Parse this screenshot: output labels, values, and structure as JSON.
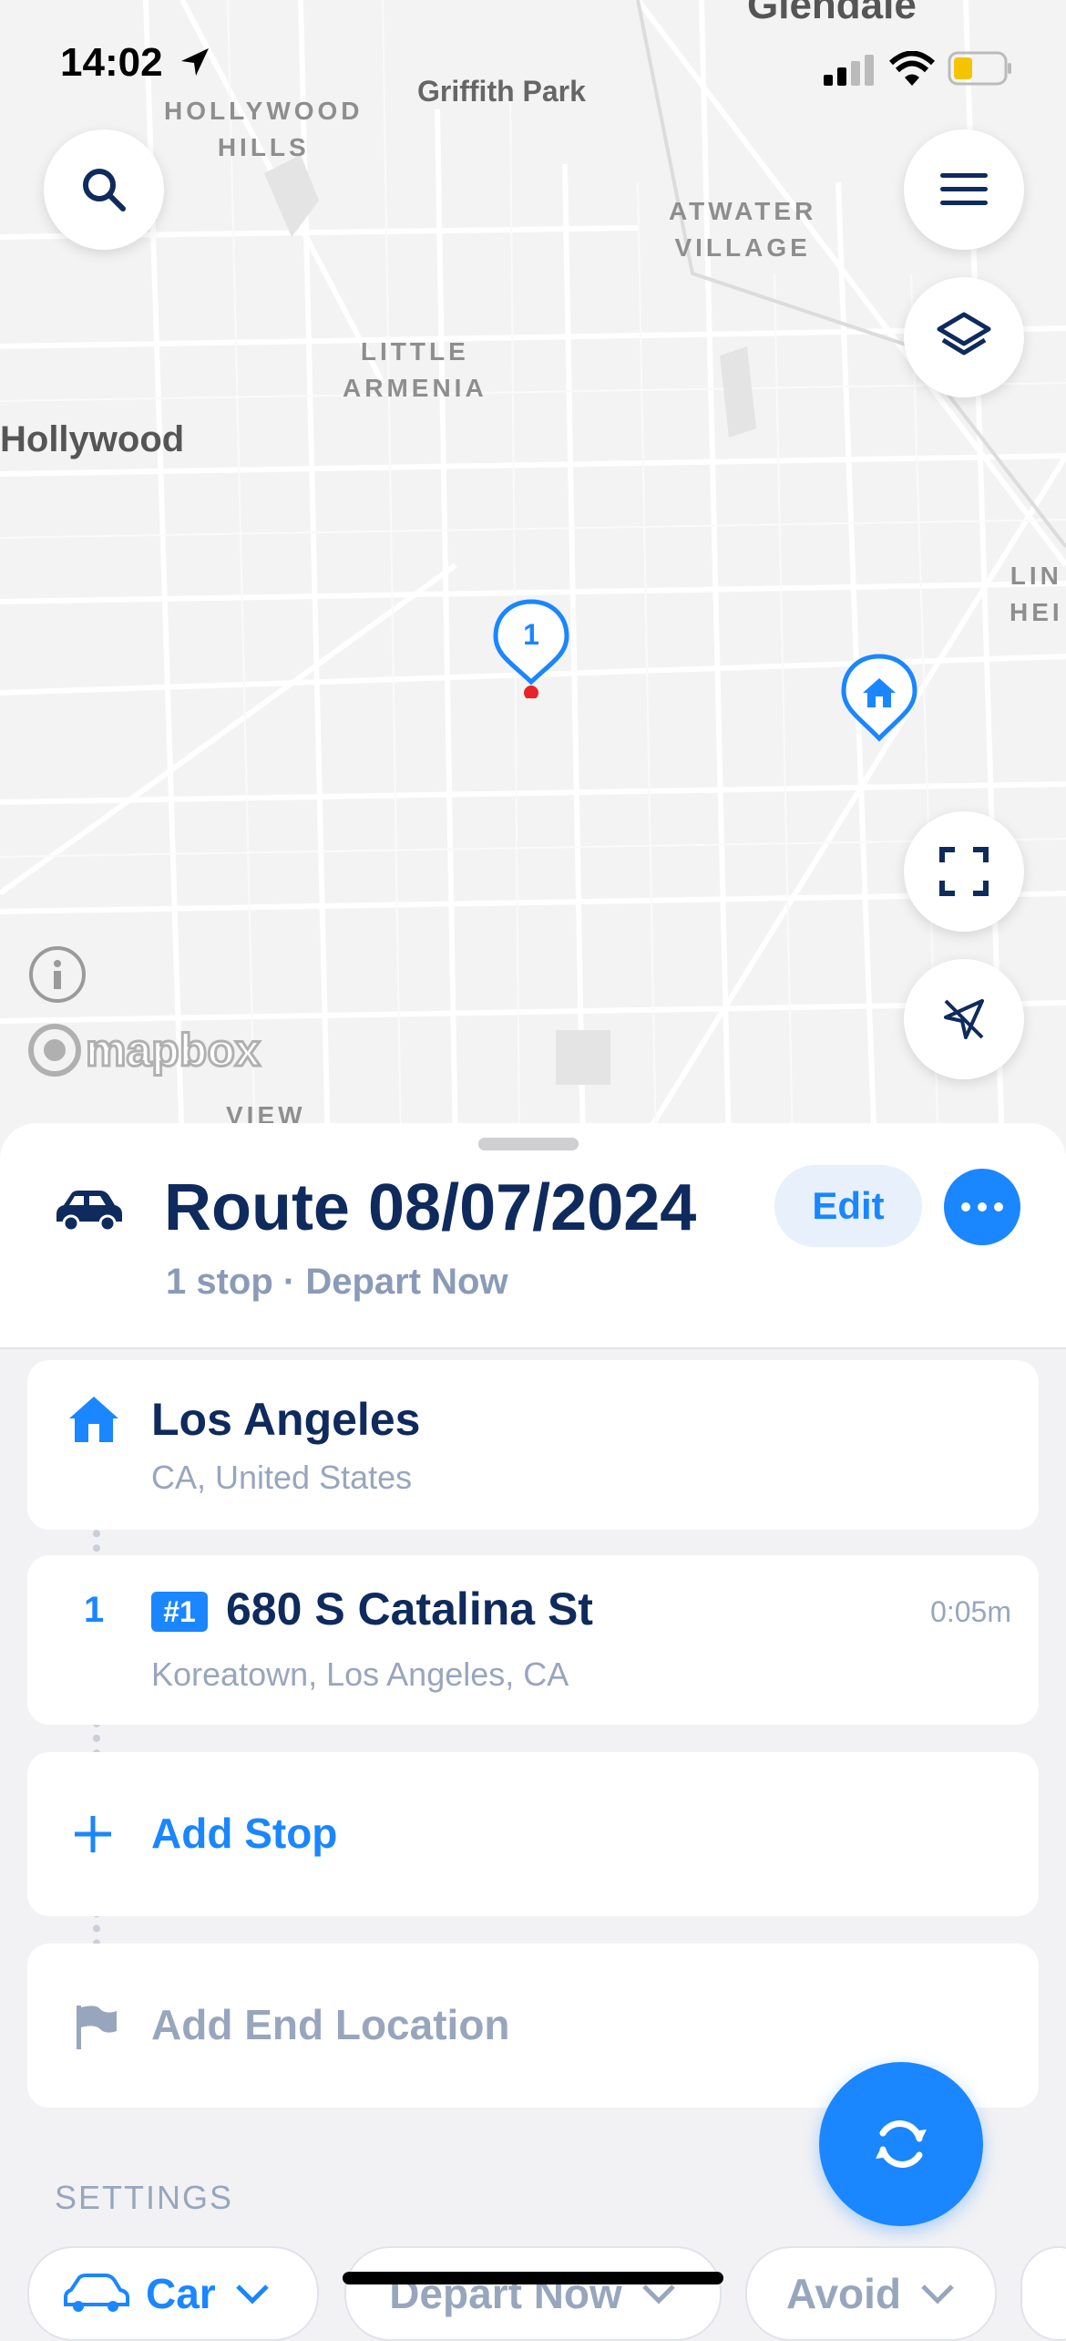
{
  "status": {
    "time": "14:02"
  },
  "map": {
    "labels": {
      "glendale": "Glendale",
      "griffith_park": "Griffith Park",
      "hollywood_hills": "HOLLYWOOD\nHILLS",
      "atwater": "ATWATER\nVILLAGE",
      "little_armenia": "LITTLE\nARMENIA",
      "hollywood": "Hollywood",
      "lin_hei": "LIN\nHEI",
      "view": "VIEW"
    },
    "stop_marker_label": "1",
    "attribution": "mapbox"
  },
  "route": {
    "title": "Route 08/07/2024",
    "subtitle": "1 stop · Depart Now",
    "edit_label": "Edit"
  },
  "stops": {
    "start": {
      "title": "Los Angeles",
      "subtitle": "CA, United States"
    },
    "stop1": {
      "number": "1",
      "badge": "#1",
      "title": "680 S Catalina St",
      "subtitle": "Koreatown, Los Angeles, CA",
      "eta": "0:05m"
    },
    "add_stop": "Add Stop",
    "add_end": "Add End Location"
  },
  "settings": {
    "label": "SETTINGS",
    "vehicle": "Car",
    "depart": "Depart Now",
    "avoid": "Avoid"
  },
  "colors": {
    "accent": "#1a86ff",
    "navy": "#0f2a5c",
    "muted": "#98a6bd"
  }
}
